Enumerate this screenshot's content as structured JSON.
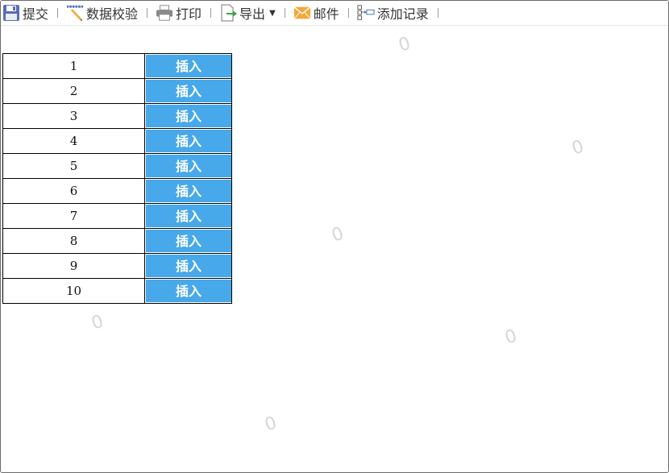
{
  "toolbar": {
    "submit_label": "提交",
    "validate_label": "数据校验",
    "print_label": "打印",
    "export_label": "导出",
    "mail_label": "邮件",
    "add_record_label": "添加记录"
  },
  "table": {
    "insert_label": "插入",
    "rows": [
      "1",
      "2",
      "3",
      "4",
      "5",
      "6",
      "7",
      "8",
      "9",
      "10"
    ]
  },
  "watermark": "0",
  "colors": {
    "button_bg": "#47a8ea",
    "button_text": "#ffffff",
    "grid_border": "#000000",
    "watermark": "#d6d6d6"
  },
  "icons": [
    "save-icon",
    "ruler-pencil-icon",
    "printer-icon",
    "export-icon",
    "mail-icon",
    "add-record-icon",
    "caret-down-icon"
  ]
}
